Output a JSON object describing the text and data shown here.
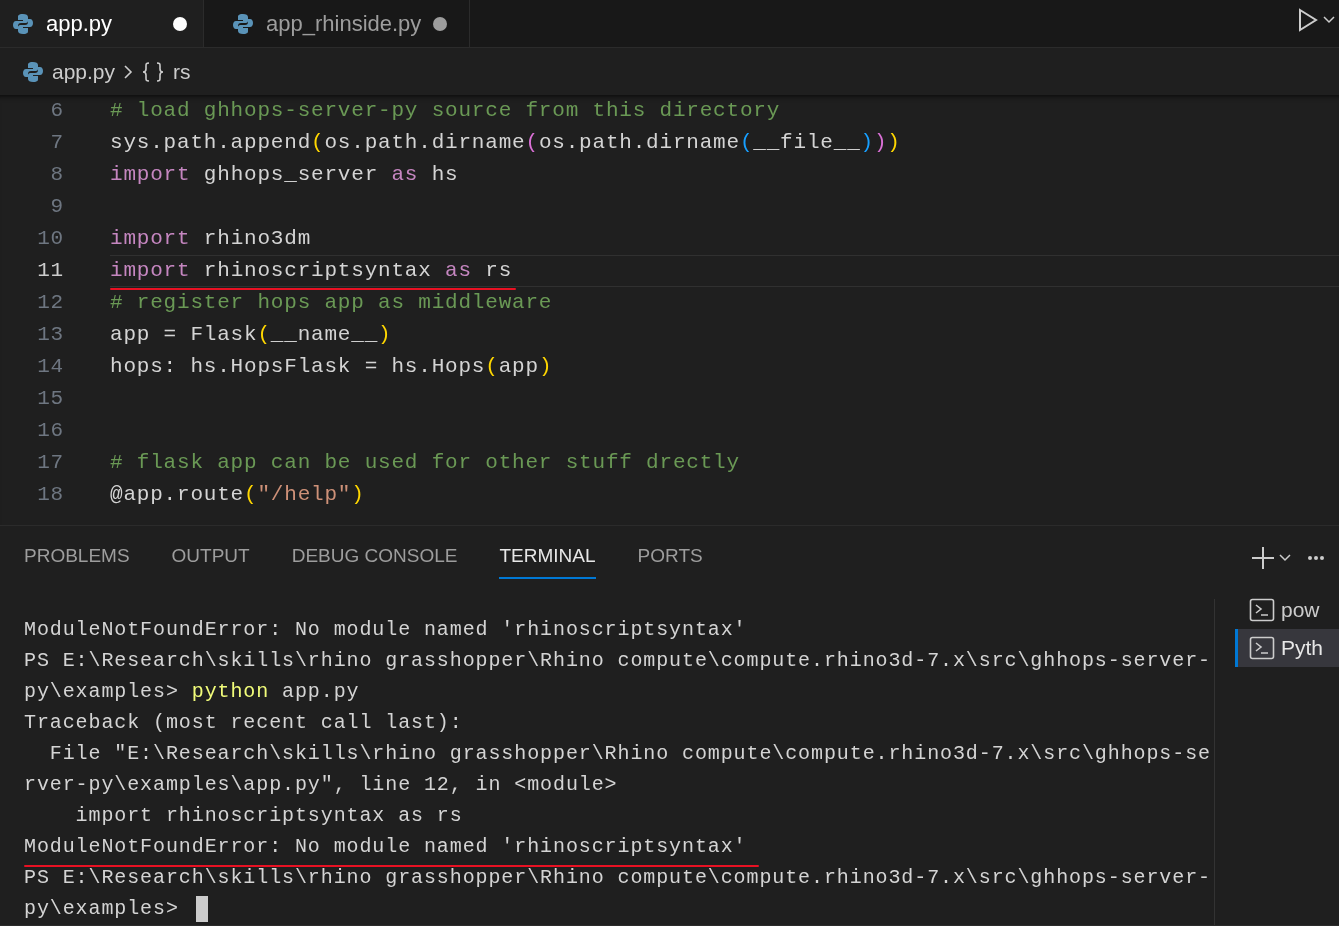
{
  "tabs": [
    {
      "label": "app.py",
      "selected": true,
      "modified": true
    },
    {
      "label": "app_rhinside.py",
      "selected": false,
      "modified": true
    }
  ],
  "breadcrumb": {
    "file": "app.py",
    "symbol": "rs"
  },
  "editor": {
    "lines": [
      {
        "number": "6",
        "current": false,
        "underlined": false,
        "tokens": [
          {
            "kind": "comment",
            "text": "# load ghhops-server-py source from this directory"
          }
        ]
      },
      {
        "number": "7",
        "current": false,
        "underlined": false,
        "tokens": [
          {
            "kind": "plain",
            "text": "sys.path.append"
          },
          {
            "kind": "bracket1",
            "text": "("
          },
          {
            "kind": "plain",
            "text": "os.path.dirname"
          },
          {
            "kind": "bracket2",
            "text": "("
          },
          {
            "kind": "plain",
            "text": "os.path.dirname"
          },
          {
            "kind": "bracket3",
            "text": "("
          },
          {
            "kind": "plain",
            "text": "__file__"
          },
          {
            "kind": "bracket3",
            "text": ")"
          },
          {
            "kind": "bracket2",
            "text": ")"
          },
          {
            "kind": "bracket1",
            "text": ")"
          }
        ]
      },
      {
        "number": "8",
        "current": false,
        "underlined": false,
        "tokens": [
          {
            "kind": "keyword",
            "text": "import"
          },
          {
            "kind": "plain",
            "text": " ghhops_server "
          },
          {
            "kind": "keyword",
            "text": "as"
          },
          {
            "kind": "plain",
            "text": " hs"
          }
        ]
      },
      {
        "number": "9",
        "current": false,
        "underlined": false
      },
      {
        "number": "10",
        "current": false,
        "underlined": false,
        "tokens": [
          {
            "kind": "keyword",
            "text": "import"
          },
          {
            "kind": "plain",
            "text": " rhino3dm"
          }
        ]
      },
      {
        "number": "11",
        "current": true,
        "underlined": true,
        "tokens": [
          {
            "kind": "keyword",
            "text": "import"
          },
          {
            "kind": "plain",
            "text": " rhinoscriptsyntax "
          },
          {
            "kind": "keyword",
            "text": "as"
          },
          {
            "kind": "plain",
            "text": " rs"
          }
        ]
      },
      {
        "number": "12",
        "current": false,
        "underlined": false,
        "tokens": [
          {
            "kind": "comment",
            "text": "# register hops app as middleware"
          }
        ]
      },
      {
        "number": "13",
        "current": false,
        "underlined": false,
        "tokens": [
          {
            "kind": "plain",
            "text": "app = Flask"
          },
          {
            "kind": "bracket1",
            "text": "("
          },
          {
            "kind": "plain",
            "text": "__name__"
          },
          {
            "kind": "bracket1",
            "text": ")"
          }
        ]
      },
      {
        "number": "14",
        "current": false,
        "underlined": false,
        "tokens": [
          {
            "kind": "plain",
            "text": "hops: hs.HopsFlask = hs.Hops"
          },
          {
            "kind": "bracket1",
            "text": "("
          },
          {
            "kind": "plain",
            "text": "app"
          },
          {
            "kind": "bracket1",
            "text": ")"
          }
        ]
      },
      {
        "number": "15",
        "current": false,
        "underlined": false
      },
      {
        "number": "16",
        "current": false,
        "underlined": false
      },
      {
        "number": "17",
        "current": false,
        "underlined": false,
        "tokens": [
          {
            "kind": "comment",
            "text": "# flask app can be used for other stuff drectly"
          }
        ]
      },
      {
        "number": "18",
        "current": false,
        "underlined": false,
        "tokens": [
          {
            "kind": "plain",
            "text": "@app.route"
          },
          {
            "kind": "bracket1",
            "text": "("
          },
          {
            "kind": "string",
            "text": "\"/help\""
          },
          {
            "kind": "bracket1",
            "text": ")"
          }
        ]
      }
    ]
  },
  "panel_tabs": [
    {
      "label": "PROBLEMS",
      "selected": false
    },
    {
      "label": "OUTPUT",
      "selected": false
    },
    {
      "label": "DEBUG CONSOLE",
      "selected": false
    },
    {
      "label": "TERMINAL",
      "selected": true
    },
    {
      "label": "PORTS",
      "selected": false
    }
  ],
  "terminal": {
    "lines": [
      {
        "underlined": false,
        "tokens": [
          {
            "kind": "plain",
            "text": "ModuleNotFoundError: No module named 'rhinoscriptsyntax'"
          }
        ]
      },
      {
        "underlined": false,
        "tokens": [
          {
            "kind": "plain",
            "text": "PS E:\\Research\\skills\\rhino grasshopper\\Rhino compute\\compute.rhino3d-7.x\\src\\ghhops-server-"
          }
        ]
      },
      {
        "underlined": false,
        "tokens": [
          {
            "kind": "plain",
            "text": "py\\examples> "
          },
          {
            "kind": "command",
            "text": "python"
          },
          {
            "kind": "plain",
            "text": " app.py"
          }
        ]
      },
      {
        "underlined": false,
        "tokens": [
          {
            "kind": "plain",
            "text": "Traceback (most recent call last):"
          }
        ]
      },
      {
        "underlined": false,
        "tokens": [
          {
            "kind": "plain",
            "text": "  File \"E:\\Research\\skills\\rhino grasshopper\\Rhino compute\\compute.rhino3d-7.x\\src\\ghhops-se"
          }
        ]
      },
      {
        "underlined": false,
        "tokens": [
          {
            "kind": "plain",
            "text": "rver-py\\examples\\app.py\", line 12, in <module>"
          }
        ]
      },
      {
        "underlined": false,
        "tokens": [
          {
            "kind": "plain",
            "text": "    import rhinoscriptsyntax as rs"
          }
        ]
      },
      {
        "underlined": true,
        "tokens": [
          {
            "kind": "plain",
            "text": "ModuleNotFoundError: No module named 'rhinoscriptsyntax'"
          }
        ]
      },
      {
        "underlined": false,
        "tokens": [
          {
            "kind": "plain",
            "text": "PS E:\\Research\\skills\\rhino grasshopper\\Rhino compute\\compute.rhino3d-7.x\\src\\ghhops-server-"
          }
        ]
      },
      {
        "underlined": false,
        "cursor": true,
        "tokens": [
          {
            "kind": "plain",
            "text": "py\\examples> "
          }
        ]
      }
    ]
  },
  "terminal_list": [
    {
      "label": "pow",
      "selected": false
    },
    {
      "label": "Pyth",
      "selected": true
    }
  ]
}
